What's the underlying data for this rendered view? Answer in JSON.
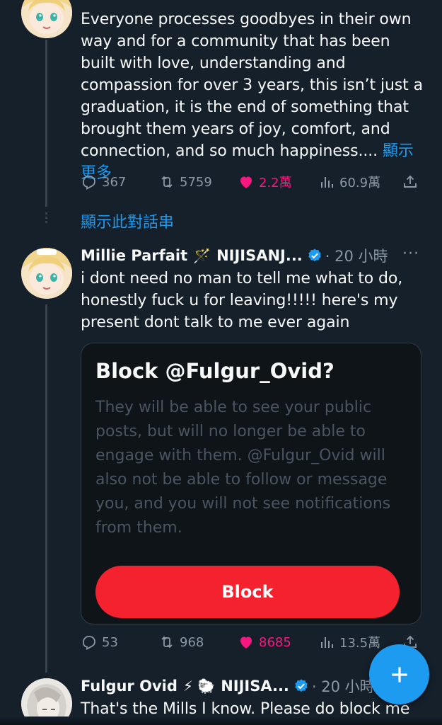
{
  "tweets": [
    {
      "text": "Everyone processes goodbyes in their own way and for a community that has been built with love, understanding and compassion for over 3 years, this isn’t just a graduation, it is the end of something that brought them years of joy, comfort, and connection, and so much happiness....",
      "show_more": "顯示更多",
      "replies": "367",
      "retweets": "5759",
      "likes": "2.2萬",
      "views": "60.9萬"
    },
    {
      "name": "Millie Parfait",
      "emoji": "🪄",
      "org": "NIJISANJ...",
      "time": "20 小時",
      "more": "···",
      "text": "i dont need no man to tell me what to do, honestly fuck u for leaving!!!!! here's my present dont talk to me ever again",
      "card": {
        "title": "Block @Fulgur_Ovid?",
        "body": "They will be able to see your public posts, but will no longer be able to engage with them. @Fulgur_Ovid will also not be able to follow or message you, and you will not see notifications from them.",
        "button": "Block"
      },
      "replies": "53",
      "retweets": "968",
      "likes": "8685",
      "views": "13.5萬"
    },
    {
      "name": "Fulgur Ovid",
      "emoji": "⚡ 🐑",
      "org": "NIJISA...",
      "time": "20 小時",
      "text": "That's the Mills I know. Please do block me"
    }
  ],
  "show_thread": "顯示此對話串",
  "colors": {
    "background": "#15202b",
    "accent": "#1d9bf0",
    "like": "#f91880",
    "danger": "#f4212e",
    "muted": "#8b98a5"
  },
  "icons": [
    "reply-icon",
    "retweet-icon",
    "heart-icon",
    "views-icon",
    "share-icon",
    "verified-icon",
    "compose-plus-icon"
  ]
}
